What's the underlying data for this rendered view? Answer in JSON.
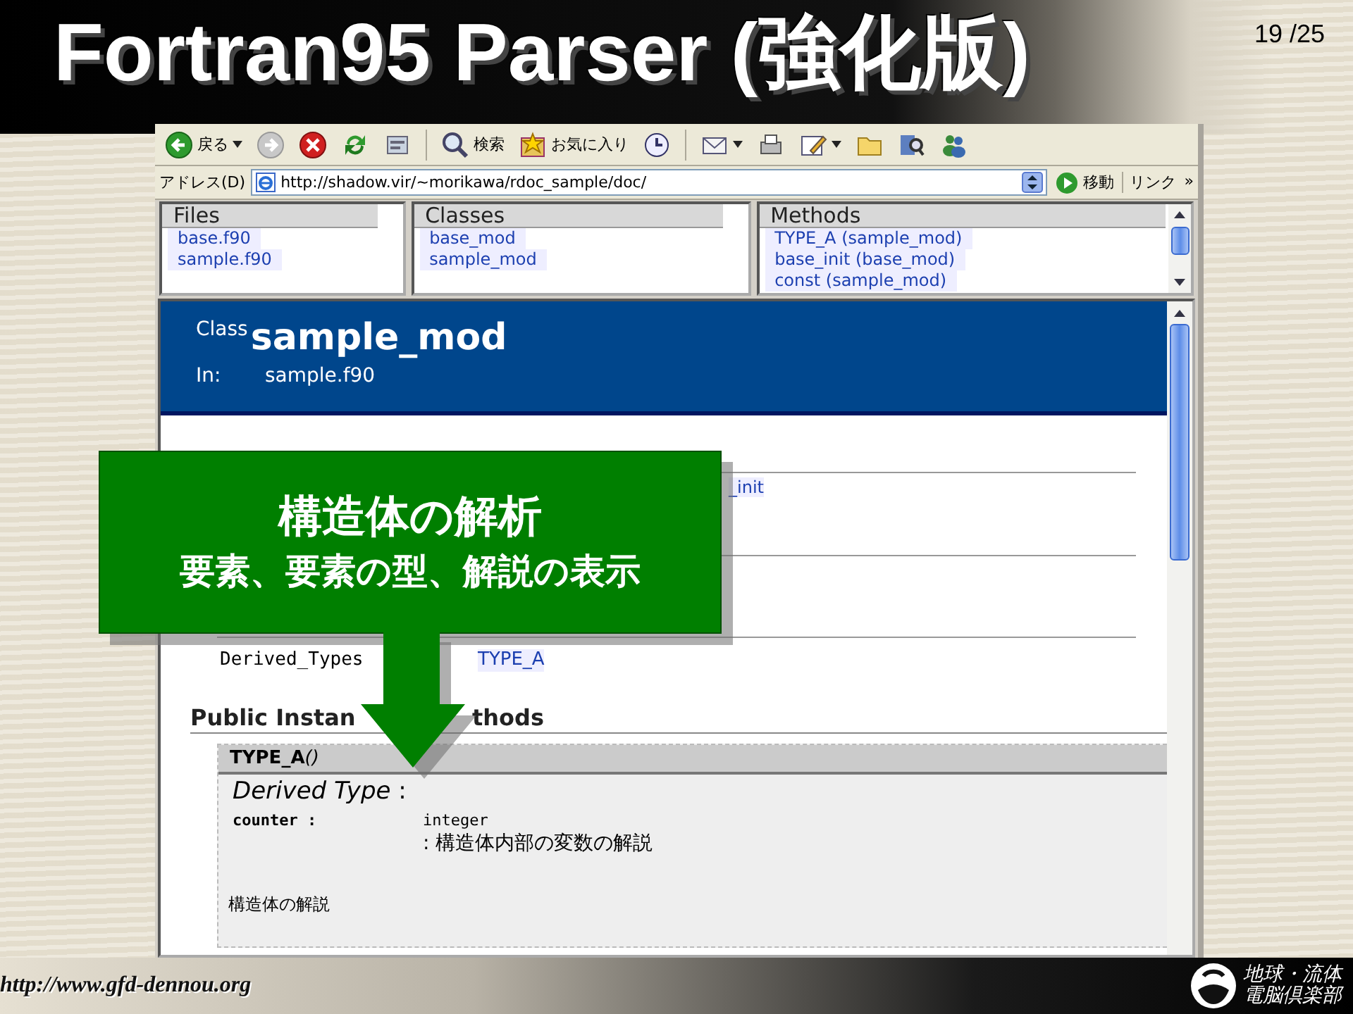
{
  "slide": {
    "title": "Fortran95 Parser (強化版)",
    "page_number": "19 /25"
  },
  "browser": {
    "toolbar": [
      {
        "kind": "back",
        "label": "戻る"
      },
      {
        "kind": "forward"
      },
      {
        "kind": "stop"
      },
      {
        "kind": "refresh"
      },
      {
        "kind": "home"
      },
      {
        "kind": "search",
        "label": "検索"
      },
      {
        "kind": "favorites",
        "label": "お気に入り"
      },
      {
        "kind": "history"
      },
      {
        "kind": "mail"
      },
      {
        "kind": "print"
      },
      {
        "kind": "edit"
      },
      {
        "kind": "folder"
      },
      {
        "kind": "find"
      },
      {
        "kind": "messenger"
      }
    ],
    "address_bar": {
      "label": "アドレス(D)",
      "url": "http://shadow.vir/~morikawa/rdoc_sample/doc/",
      "go_label": "移動",
      "links_label": "リンク",
      "more": "»"
    },
    "frames": [
      {
        "title": "Files",
        "links": [
          "base.f90",
          "sample.f90"
        ]
      },
      {
        "title": "Classes",
        "links": [
          "base_mod",
          "sample_mod"
        ]
      },
      {
        "title": "Methods",
        "links": [
          "TYPE_A (sample_mod)",
          "base_init (base_mod)",
          "const (sample_mod)"
        ]
      }
    ],
    "page": {
      "header": {
        "label": "Class",
        "name": "sample_mod",
        "in_label": "In:",
        "in_file": "sample.f90"
      },
      "methods_fragment": "_init",
      "derived_types": {
        "label": "Derived_Types",
        "link": "TYPE_A"
      },
      "section_heading": [
        "Public Instan",
        "thods"
      ],
      "method": {
        "signature": "TYPE_A",
        "signature_parens": "()",
        "kind_label": "*Derived Type* :",
        "fields": [
          {
            "name": "counter :",
            "type": "integer",
            "description": ": 構造体内部の変数の解説"
          }
        ],
        "description": "構造体の解説"
      }
    }
  },
  "callout": {
    "title": "構造体の解析",
    "subtitle": "要素、要素の型、解説の表示"
  },
  "footer": {
    "url": "http://www.gfd-dennou.org",
    "logo_text": [
      "地球・流体",
      "電脳倶楽部"
    ]
  }
}
